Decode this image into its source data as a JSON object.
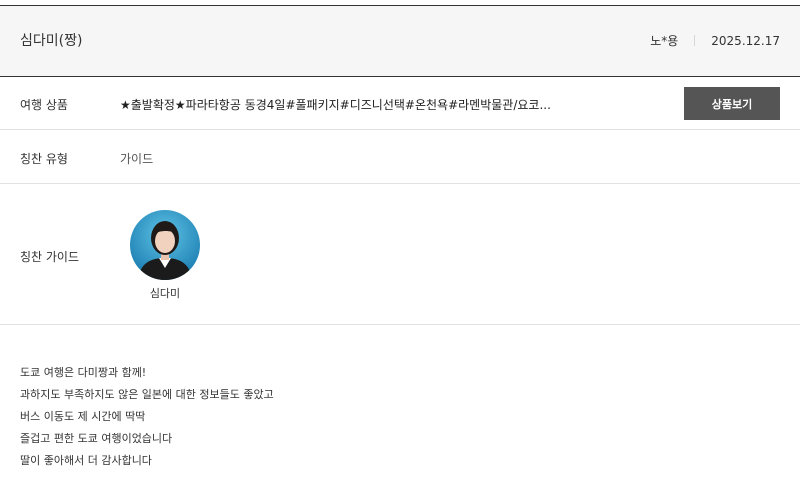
{
  "review": {
    "title": "심다미(짱)",
    "author": "노*용",
    "date": "2025.12.17"
  },
  "rows": {
    "product_label": "여행 상품",
    "product_value": "★출발확정★파라타항공 동경4일#풀패키지#디즈니선택#온천욕#라멘박물관/요코...",
    "product_button": "상품보기",
    "type_label": "칭찬 유형",
    "type_value": "가이드",
    "guide_label": "칭찬 가이드",
    "guide_name": "심다미"
  },
  "body_lines": [
    "도쿄 여행은 다미짱과 함께!",
    "과하지도 부족하지도 않은 일본에 대한 정보들도 좋았고",
    "버스 이동도 제 시간에 딱딱",
    "즐겁고 편한 도쿄 여행이었습니다",
    "딸이 좋아해서 더 감사합니다"
  ]
}
